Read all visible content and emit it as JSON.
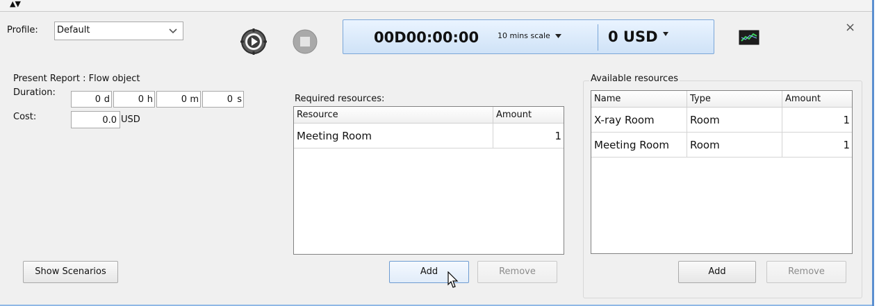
{
  "toolbar": {
    "collapse_arrows": "▲▼",
    "profile_label": "Profile:",
    "profile_value": "Default",
    "timer": "00D00:00:00",
    "scale": "10 mins scale",
    "cost": "0 USD",
    "close_glyph": "×"
  },
  "present_report": {
    "title": "Present Report : Flow object",
    "duration_label": "Duration:",
    "duration": [
      {
        "value": "0",
        "unit": "d"
      },
      {
        "value": "0",
        "unit": "h"
      },
      {
        "value": "0",
        "unit": "m"
      },
      {
        "value": "0",
        "unit": "s"
      }
    ],
    "cost_label": "Cost:",
    "cost_value": "0.0",
    "cost_unit": "USD",
    "show_scenarios_label": "Show Scenarios"
  },
  "required_resources": {
    "title": "Required resources:",
    "columns": [
      "Resource",
      "Amount"
    ],
    "rows": [
      {
        "resource": "Meeting Room",
        "amount": "1"
      }
    ],
    "add_label": "Add",
    "remove_label": "Remove"
  },
  "available_resources": {
    "title": "Available resources",
    "columns": [
      "Name",
      "Type",
      "Amount"
    ],
    "rows": [
      {
        "name": "X-ray Room",
        "type": "Room",
        "amount": "1"
      },
      {
        "name": "Meeting Room",
        "type": "Room",
        "amount": "1"
      }
    ],
    "add_label": "Add",
    "remove_label": "Remove"
  },
  "icons": {
    "run": "run-simulation-icon",
    "stop": "stop-icon",
    "chart": "chart-icon",
    "dropdown": "chevron-down-icon",
    "cursor": "mouse-pointer-icon"
  },
  "colors": {
    "accent_blue": "#5b8fd0",
    "sim_panel_bg": "#dbeafb",
    "stop_gray": "#9b9b9b",
    "chart_green": "#2fa04a"
  }
}
